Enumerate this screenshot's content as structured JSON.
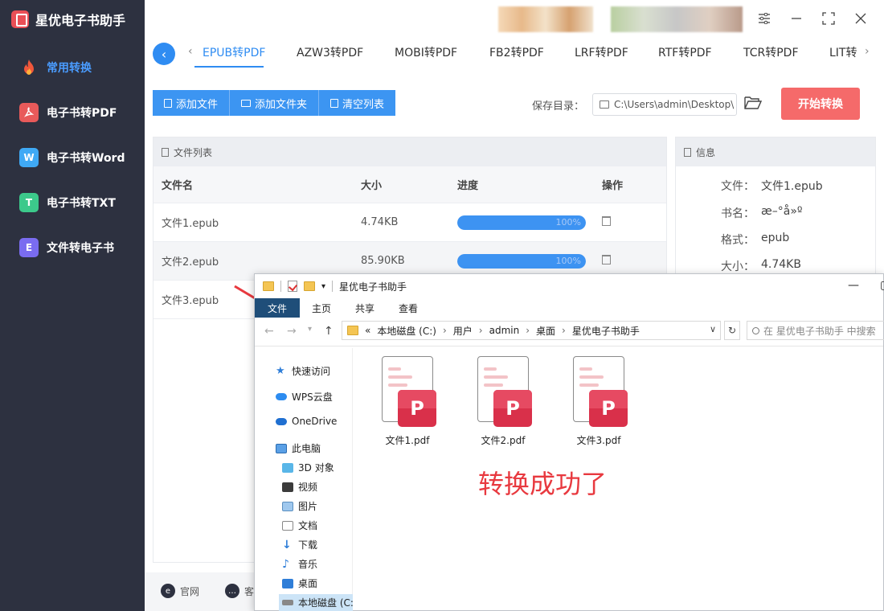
{
  "app": {
    "title": "星优电子书助手",
    "sidebar": [
      {
        "label": "常用转换",
        "icon": "flame-icon",
        "active": true
      },
      {
        "label": "电子书转PDF",
        "icon": "pdf-icon"
      },
      {
        "label": "电子书转Word",
        "icon": "word-icon",
        "glyph": "W"
      },
      {
        "label": "电子书转TXT",
        "icon": "txt-icon",
        "glyph": "T"
      },
      {
        "label": "文件转电子书",
        "icon": "ebook-icon",
        "glyph": "E"
      }
    ],
    "tabs": [
      "EPUB转PDF",
      "AZW3转PDF",
      "MOBI转PDF",
      "FB2转PDF",
      "LRF转PDF",
      "RTF转PDF",
      "TCR转PDF",
      "LIT转"
    ],
    "active_tab": "EPUB转PDF",
    "toolbar": {
      "add_file": "添加文件",
      "add_folder": "添加文件夹",
      "clear_list": "清空列表"
    },
    "save": {
      "label": "保存目录：",
      "path": "C:\\Users\\admin\\Desktop\\"
    },
    "start_button": "开始转换",
    "file_list": {
      "title": "文件列表",
      "columns": [
        "文件名",
        "大小",
        "进度",
        "操作"
      ],
      "rows": [
        {
          "name": "文件1.epub",
          "size": "4.74KB",
          "progress": 100,
          "progress_text": "100%"
        },
        {
          "name": "文件2.epub",
          "size": "85.90KB",
          "progress": 100,
          "progress_text": "100%"
        },
        {
          "name": "文件3.epub",
          "size": "",
          "progress": 0,
          "progress_text": ""
        }
      ]
    },
    "info": {
      "title": "信息",
      "rows": [
        {
          "key": "文件：",
          "value": "文件1.epub"
        },
        {
          "key": "书名：",
          "value": "æ–°å»º"
        },
        {
          "key": "格式：",
          "value": "epub"
        },
        {
          "key": "大小：",
          "value": "4.74KB"
        }
      ]
    },
    "footer": {
      "website": "官网",
      "support": "客"
    }
  },
  "explorer": {
    "title": "星优电子书助手",
    "ribbon": [
      "文件",
      "主页",
      "共享",
      "查看"
    ],
    "breadcrumb": [
      "本地磁盘 (C:)",
      "用户",
      "admin",
      "桌面",
      "星优电子书助手"
    ],
    "breadcrumb_prefix": "«",
    "search_placeholder": "在 星优电子书助手 中搜索",
    "tree": [
      {
        "label": "快速访问",
        "icon": "star-icon"
      },
      {
        "label": "WPS云盘",
        "icon": "cloud-icon"
      },
      {
        "label": "OneDrive",
        "icon": "onedrive-icon"
      },
      {
        "label": "此电脑",
        "icon": "computer-icon"
      },
      {
        "label": "3D 对象",
        "icon": "cube-icon"
      },
      {
        "label": "视频",
        "icon": "video-icon"
      },
      {
        "label": "图片",
        "icon": "picture-icon"
      },
      {
        "label": "文档",
        "icon": "document-icon"
      },
      {
        "label": "下载",
        "icon": "download-icon"
      },
      {
        "label": "音乐",
        "icon": "music-icon"
      },
      {
        "label": "桌面",
        "icon": "desktop-icon"
      },
      {
        "label": "本地磁盘 (C:",
        "icon": "drive-icon",
        "selected": true
      }
    ],
    "files": [
      "文件1.pdf",
      "文件2.pdf",
      "文件3.pdf"
    ],
    "annotation": "转换成功了"
  },
  "colors": {
    "sidebar_bg": "#2d3140",
    "accent": "#2f8cf2",
    "start_button": "#f56a6a",
    "annotation": "#e8393f"
  }
}
